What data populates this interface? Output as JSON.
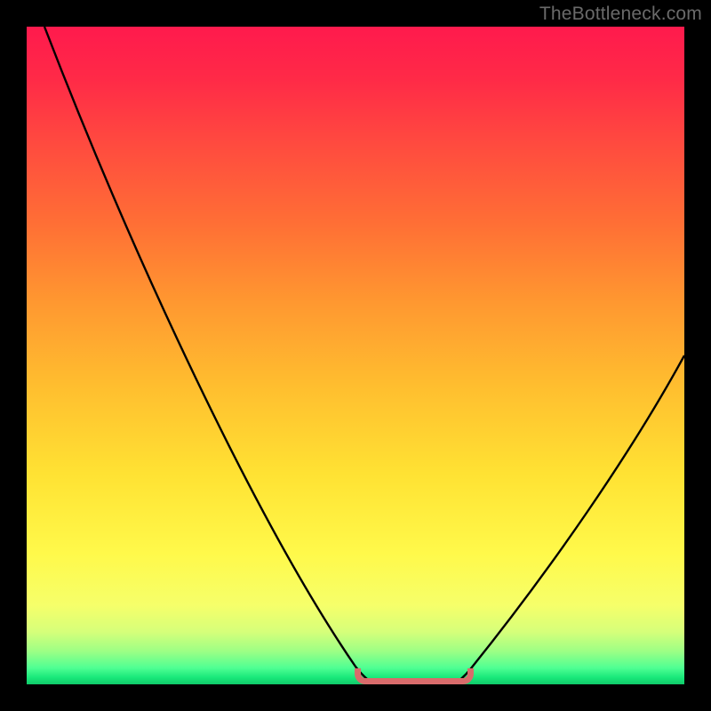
{
  "watermark": "TheBottleneck.com",
  "chart_data": {
    "type": "line",
    "title": "",
    "xlabel": "",
    "ylabel": "",
    "xlim": [
      0,
      100
    ],
    "ylim": [
      0,
      100
    ],
    "grid": false,
    "x": [
      0,
      6,
      12,
      18,
      24,
      30,
      36,
      42,
      48,
      52,
      56,
      59,
      62,
      66,
      70,
      76,
      82,
      88,
      94,
      100
    ],
    "values": [
      100,
      90,
      80,
      70,
      60,
      50,
      40,
      30,
      18,
      10,
      4,
      1,
      0,
      1,
      4,
      12,
      22,
      34,
      46,
      58
    ],
    "background_gradient_stops": [
      {
        "pos": 0.0,
        "color": "#ff1a4d"
      },
      {
        "pos": 0.3,
        "color": "#ff6f35"
      },
      {
        "pos": 0.55,
        "color": "#ffbf2f"
      },
      {
        "pos": 0.8,
        "color": "#fff94a"
      },
      {
        "pos": 0.95,
        "color": "#9cff85"
      },
      {
        "pos": 1.0,
        "color": "#10c96a"
      }
    ],
    "marker": {
      "x_start": 50,
      "x_end": 68,
      "color": "#d96b6b"
    }
  }
}
